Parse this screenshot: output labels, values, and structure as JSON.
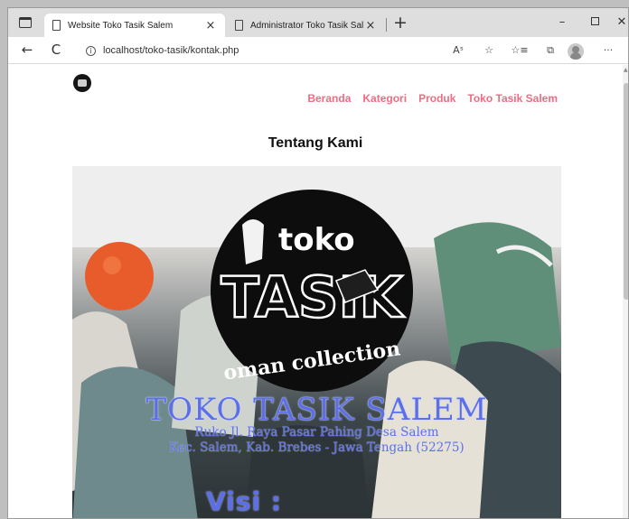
{
  "browser": {
    "tabs": [
      {
        "title": "Website Toko Tasik Salem",
        "close": "×"
      },
      {
        "title": "Administrator Toko Tasik Salem",
        "close": "×"
      }
    ],
    "new_tab": "+",
    "controls": {
      "minimize": "–",
      "close": "✕"
    },
    "nav": {
      "back": "←",
      "reload": "C"
    },
    "address": {
      "info": "i",
      "url": "localhost/toko-tasik/kontak.php"
    },
    "toolbar": {
      "read_aloud": "Aˢ",
      "add_favorite": "☆",
      "favorites": "☆≡",
      "collections": "⧉",
      "more": "···"
    }
  },
  "site": {
    "nav": [
      "Beranda",
      "Kategori",
      "Produk",
      "Toko Tasik Salem"
    ],
    "page_title": "Tentang Kami",
    "hero": {
      "logo_word_top": "toko",
      "logo_word_main": "TASIK",
      "logo_word_bottom": "oman collection",
      "store_name": "TOKO TASIK SALEM",
      "address_line1": "Ruko Jl. Raya Pasar Pahing Desa Salem",
      "address_line2": "Kec. Salem, Kab. Brebes - Jawa Tengah (52275)",
      "visi_heading": "Visi :"
    }
  },
  "colors": {
    "nav_link": "#f06b83",
    "hero_text": "#5d6fe6"
  }
}
